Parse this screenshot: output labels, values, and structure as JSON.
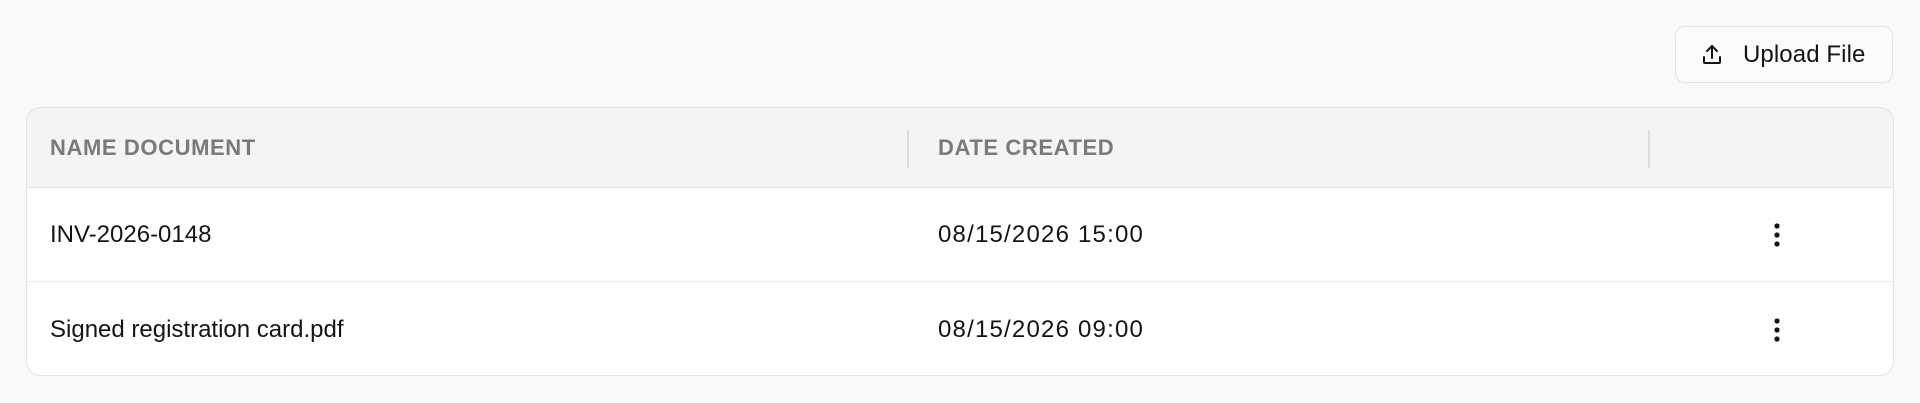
{
  "toolbar": {
    "upload_label": "Upload File",
    "upload_icon": "upload-icon"
  },
  "table": {
    "columns": [
      "NAME DOCUMENT",
      "DATE CREATED",
      ""
    ],
    "rows": [
      {
        "name": "INV-2026-0148",
        "date_created": "08/15/2026 15:00",
        "menu_icon": "more-vertical-icon"
      },
      {
        "name": "Signed registration card.pdf",
        "date_created": "08/15/2026 09:00",
        "menu_icon": "more-vertical-icon"
      }
    ]
  },
  "colors": {
    "page_background": "#f9f9f9",
    "header_background": "#f4f4f4",
    "border": "#e2e2e2",
    "header_text": "#7a7a7a",
    "body_text": "#141414"
  }
}
